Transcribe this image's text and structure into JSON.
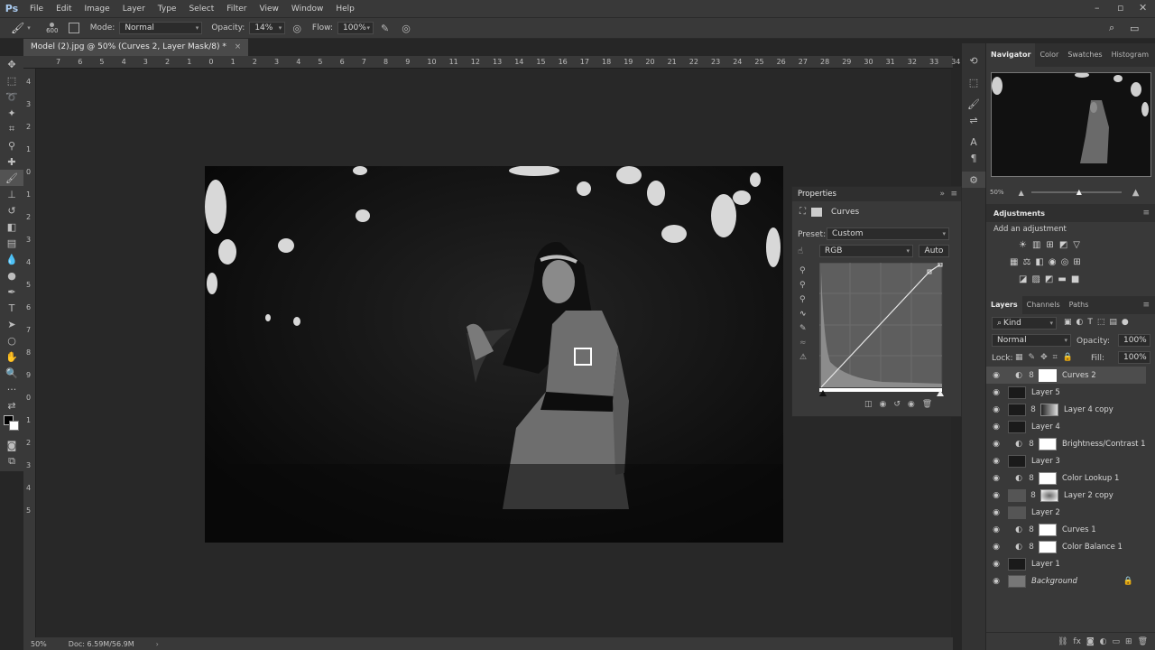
{
  "menubar": {
    "logo": "Ps",
    "items": [
      "File",
      "Edit",
      "Image",
      "Layer",
      "Type",
      "Select",
      "Filter",
      "View",
      "Window",
      "Help"
    ]
  },
  "options": {
    "brush_size": "600",
    "mode_label": "Mode:",
    "mode_value": "Normal",
    "opacity_label": "Opacity:",
    "opacity_value": "14%",
    "flow_label": "Flow:",
    "flow_value": "100%"
  },
  "document": {
    "tab_title": "Model (2).jpg @ 50% (Curves 2, Layer Mask/8) *",
    "close": "×"
  },
  "ruler_top": [
    "7",
    "6",
    "5",
    "4",
    "3",
    "2",
    "1",
    "0",
    "1",
    "2",
    "3",
    "4",
    "5",
    "6",
    "7",
    "8",
    "9",
    "10",
    "11",
    "12",
    "13",
    "14",
    "15",
    "16",
    "17",
    "18",
    "19",
    "20",
    "21",
    "22",
    "23",
    "24",
    "25",
    "26",
    "27",
    "28",
    "29",
    "30",
    "31",
    "32",
    "33",
    "34"
  ],
  "ruler_left": [
    "4",
    "3",
    "2",
    "1",
    "0",
    "1",
    "2",
    "3",
    "4",
    "5",
    "6",
    "7",
    "8",
    "9",
    "0",
    "1",
    "2",
    "3",
    "4",
    "5"
  ],
  "status": {
    "zoom": "50%",
    "doc": "Doc: 6.59M/56.9M"
  },
  "navigator": {
    "tabs": [
      "Navigator",
      "Color",
      "Swatches",
      "Histogram"
    ],
    "zoom": "50%"
  },
  "properties": {
    "title": "Properties",
    "type_label": "Curves",
    "preset_label": "Preset:",
    "preset_value": "Custom",
    "channel_value": "RGB",
    "auto_label": "Auto"
  },
  "adjustments": {
    "title": "Adjustments",
    "subtitle": "Add an adjustment"
  },
  "layers_panel": {
    "tabs": [
      "Layers",
      "Channels",
      "Paths"
    ],
    "filter_label": "Kind",
    "blend_mode": "Normal",
    "opacity_label": "Opacity:",
    "opacity_value": "100%",
    "lock_label": "Lock:",
    "fill_label": "Fill:",
    "fill_value": "100%",
    "layers": [
      {
        "name": "Curves 2",
        "type": "adjustment",
        "selected": true
      },
      {
        "name": "Layer 5",
        "type": "pixel"
      },
      {
        "name": "Layer 4 copy",
        "type": "pixel-mask"
      },
      {
        "name": "Layer 4",
        "type": "pixel"
      },
      {
        "name": "Brightness/Contrast 1",
        "type": "adjustment"
      },
      {
        "name": "Layer 3",
        "type": "pixel"
      },
      {
        "name": "Color Lookup 1",
        "type": "adjustment"
      },
      {
        "name": "Layer 2 copy",
        "type": "pixel-mask"
      },
      {
        "name": "Layer 2",
        "type": "pixel"
      },
      {
        "name": "Curves 1",
        "type": "adjustment"
      },
      {
        "name": "Color Balance 1",
        "type": "adjustment"
      },
      {
        "name": "Layer 1",
        "type": "pixel"
      },
      {
        "name": "Background",
        "type": "background"
      }
    ]
  }
}
